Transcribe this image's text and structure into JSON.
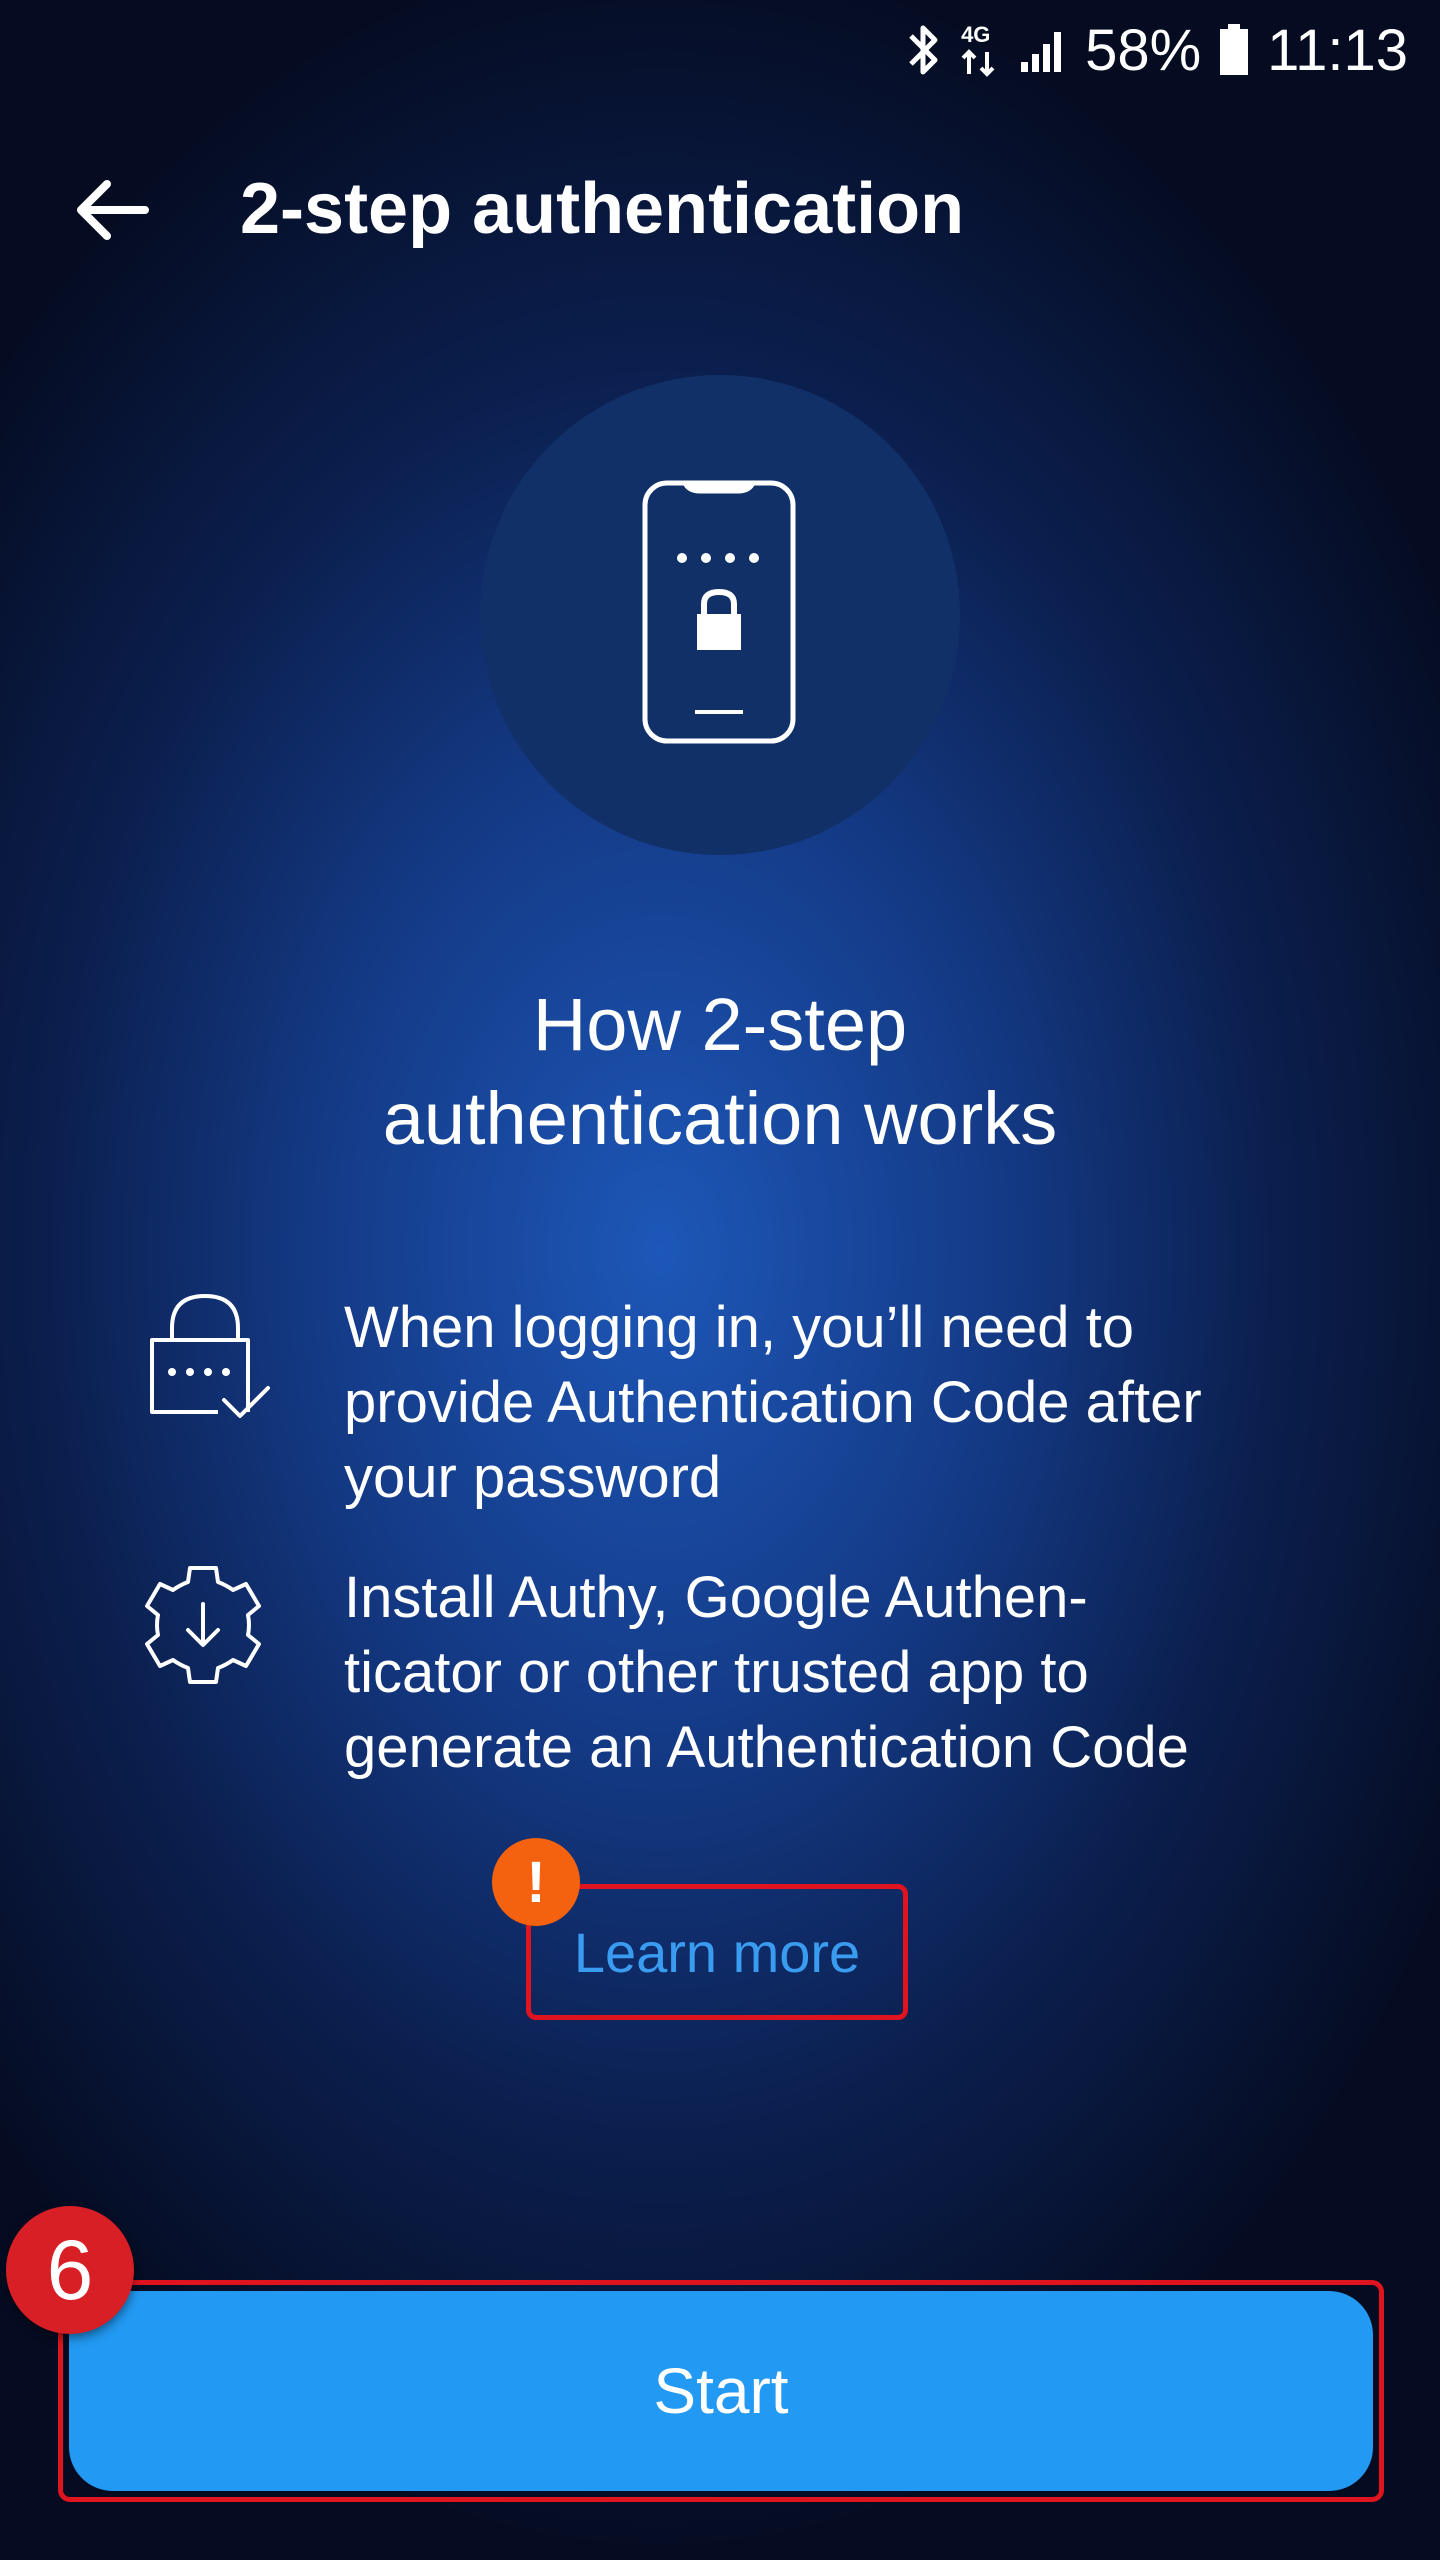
{
  "status_bar": {
    "network": "4G",
    "battery_percent": "58%",
    "time": "11:13"
  },
  "app_bar": {
    "title": "2-step authentication"
  },
  "main": {
    "heading_line1": "How 2-step",
    "heading_line2": "authentication works",
    "features": [
      {
        "icon": "padlock-code-check-icon",
        "line1": "When logging in, you’ll need to",
        "line2": "provide Authentication Code after",
        "line3": "your password"
      },
      {
        "icon": "gear-download-icon",
        "line1": "Install Authy, Google Authen-",
        "line2": "ticator or other trusted app to",
        "line3": "generate an Authentication Code"
      }
    ],
    "learn_more_label": "Learn more",
    "start_label": "Start"
  },
  "annotations": {
    "warning_badge": "!",
    "step_number": "6"
  },
  "colors": {
    "accent_button": "#2299f2",
    "link": "#3a9cf0",
    "highlight_border": "#e0141e",
    "warning_badge": "#f5620f",
    "step_badge": "#d91f26"
  }
}
